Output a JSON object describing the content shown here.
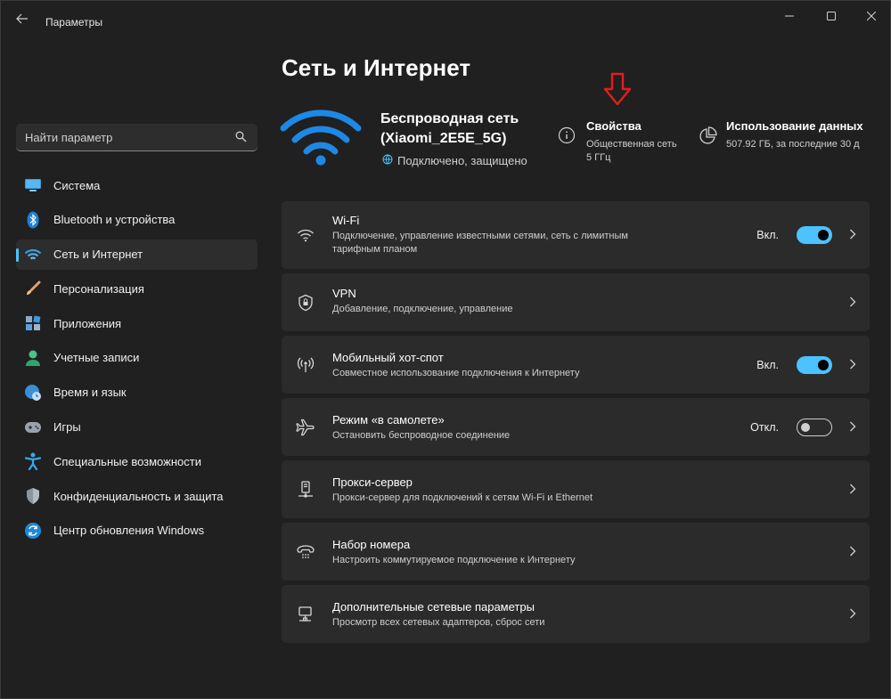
{
  "window": {
    "title": "Параметры",
    "back_icon": "back-arrow-icon",
    "controls": [
      "minimize-icon",
      "maximize-icon",
      "close-icon"
    ]
  },
  "search": {
    "placeholder": "Найти параметр",
    "icon": "search-icon"
  },
  "sidebar": {
    "items": [
      {
        "label": "Система",
        "icon": "system-monitor-icon",
        "active": false
      },
      {
        "label": "Bluetooth и устройства",
        "icon": "bluetooth-icon",
        "active": false
      },
      {
        "label": "Сеть и Интернет",
        "icon": "wifi-icon",
        "active": true
      },
      {
        "label": "Персонализация",
        "icon": "brush-icon",
        "active": false
      },
      {
        "label": "Приложения",
        "icon": "apps-icon",
        "active": false
      },
      {
        "label": "Учетные записи",
        "icon": "account-icon",
        "active": false
      },
      {
        "label": "Время и язык",
        "icon": "clock-globe-icon",
        "active": false
      },
      {
        "label": "Игры",
        "icon": "gamepad-icon",
        "active": false
      },
      {
        "label": "Специальные возможности",
        "icon": "accessibility-icon",
        "active": false
      },
      {
        "label": "Конфиденциальность и защита",
        "icon": "shield-icon",
        "active": false
      },
      {
        "label": "Центр обновления Windows",
        "icon": "update-icon",
        "active": false
      }
    ]
  },
  "main": {
    "title": "Сеть и Интернет",
    "network": {
      "name": "Беспроводная сеть (Xiaomi_2E5E_5G)",
      "status": "Подключено, защищено"
    },
    "properties": {
      "title": "Свойства",
      "line1": "Общественная сеть",
      "line2": "5 ГГц"
    },
    "usage": {
      "title": "Использование данных",
      "line1": "507.92 ГБ, за последние 30 д"
    },
    "cards": [
      {
        "title": "Wi-Fi",
        "desc": "Подключение, управление известными сетями, сеть с лимитным тарифным планом",
        "icon": "wifi-icon",
        "toggle_label": "Вкл.",
        "toggle": true
      },
      {
        "title": "VPN",
        "desc": "Добавление, подключение, управление",
        "icon": "vpn-shield-icon"
      },
      {
        "title": "Мобильный хот-спот",
        "desc": "Совместное использование подключения к Интернету",
        "icon": "hotspot-icon",
        "toggle_label": "Вкл.",
        "toggle": true
      },
      {
        "title": "Режим «в самолете»",
        "desc": "Остановить беспроводное соединение",
        "icon": "airplane-icon",
        "toggle_label": "Откл.",
        "toggle": false
      },
      {
        "title": "Прокси-сервер",
        "desc": "Прокси-сервер для подключений к сетям Wi-Fi и Ethernet",
        "icon": "proxy-icon"
      },
      {
        "title": "Набор номера",
        "desc": "Настроить коммутируемое подключение к Интернету",
        "icon": "dialup-icon"
      },
      {
        "title": "Дополнительные сетевые параметры",
        "desc": "Просмотр всех сетевых адаптеров, сброс сети",
        "icon": "network-adapter-icon"
      }
    ]
  },
  "colors": {
    "accent": "#4cc2ff",
    "background": "#202020",
    "card": "#2b2b2b",
    "annotation_arrow": "#e81b1b"
  }
}
